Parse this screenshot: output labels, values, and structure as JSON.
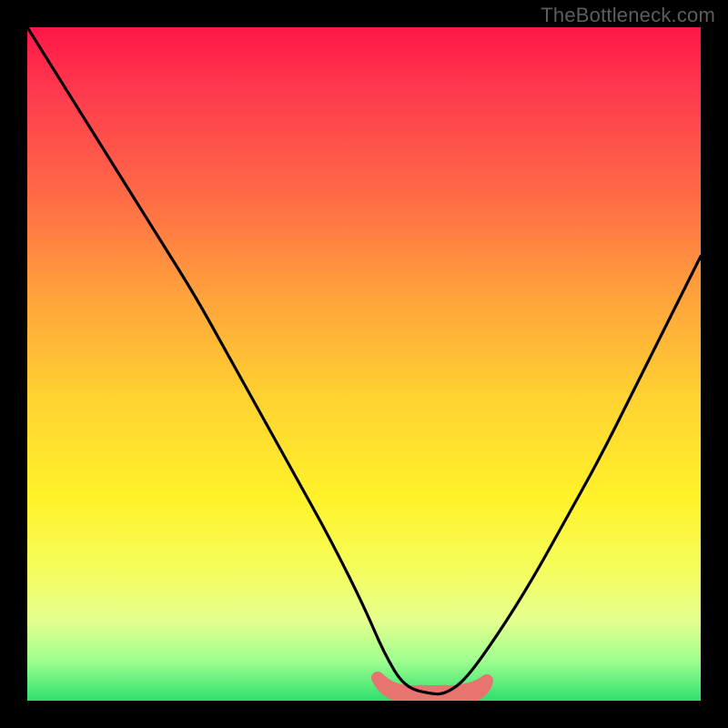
{
  "watermark": "TheBottleneck.com",
  "chart_data": {
    "type": "line",
    "title": "",
    "xlabel": "",
    "ylabel": "",
    "xrange": [
      0,
      100
    ],
    "yrange": [
      0,
      100
    ],
    "series": [
      {
        "name": "curve",
        "x": [
          0,
          5,
          10,
          15,
          20,
          25,
          30,
          35,
          40,
          45,
          50,
          53,
          56,
          60,
          62,
          65,
          70,
          75,
          80,
          85,
          90,
          95,
          100
        ],
        "values": [
          100,
          92,
          84,
          76,
          68,
          60,
          51,
          42,
          33,
          24,
          14,
          7,
          2,
          1,
          1,
          3,
          10,
          18,
          27,
          36,
          46,
          56,
          66
        ]
      },
      {
        "name": "bottom-band",
        "x": [
          52,
          68
        ],
        "values": [
          0,
          0
        ]
      }
    ],
    "legend": false,
    "grid": false,
    "background": "rainbow-vertical"
  }
}
